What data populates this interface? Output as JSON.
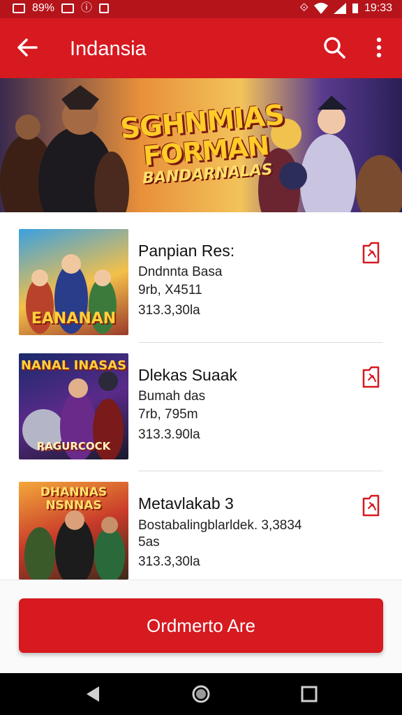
{
  "status_bar": {
    "battery_text": "89%",
    "time": "19:33"
  },
  "app_bar": {
    "title": "Indansia",
    "back_icon": "arrow-left-icon",
    "search_icon": "search-icon",
    "more_icon": "more-vert-icon"
  },
  "banner": {
    "title_line1": "SGHNMIAS",
    "title_line2": "FORMAN",
    "subtitle": "BANDARNALAS"
  },
  "items": [
    {
      "name": "Panpian Res:",
      "line1": "Dndnnta Basa",
      "line2": "9rb, X4511",
      "line3": "313.3,30la",
      "thumb_text": "EANANAN"
    },
    {
      "name": "Dlekas Suaak",
      "line1": "Bumah das",
      "line2": "7rb, 795m",
      "line3": "313.3.90la",
      "thumb_text_top": "NANAL INASAS",
      "thumb_text": "RAGURCOCK"
    },
    {
      "name": "Metavlakab 3",
      "line1": "Bostabalingblarldek. 3,3834",
      "line2": "5as",
      "line3": "313.3,30la",
      "thumb_text_top": "DHANNAS NSNNAS"
    }
  ],
  "cta": {
    "label": "Ordmerto  Are"
  },
  "nav_bar": {
    "back": "nav-back-icon",
    "home": "nav-home-icon",
    "recents": "nav-recents-icon"
  },
  "colors": {
    "primary": "#d71920",
    "status_bar": "#b5141b"
  }
}
